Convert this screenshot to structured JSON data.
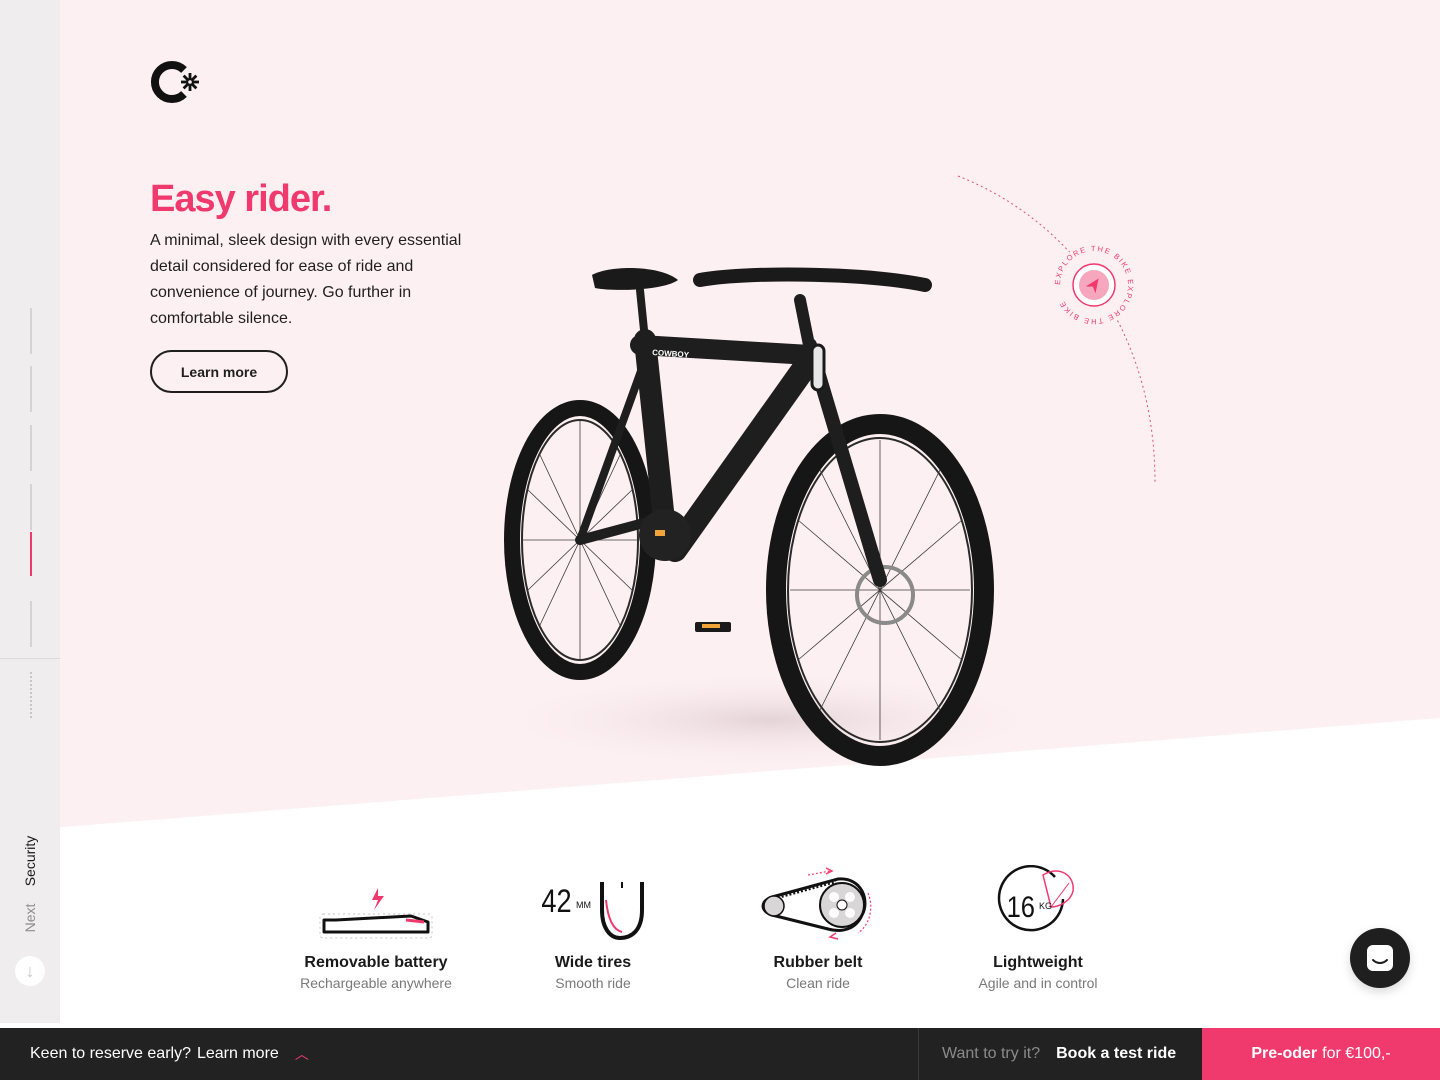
{
  "brand": {
    "logo_icon": "cowboy-logo-icon"
  },
  "sidebar": {
    "next_label": "Next",
    "section_label": "Security",
    "down_icon": "arrow-down-icon",
    "active_index": 4
  },
  "hero": {
    "title": "Easy rider.",
    "description": "A minimal, sleek design with every essential detail considered for ease of ride and convenience of journey. Go further in comfortable silence.",
    "cta_label": "Learn more",
    "bike_brand": "COWBOY",
    "explore_badge_text": "EXPLORE THE BIKE EXPLORE THE BIKE"
  },
  "features": [
    {
      "icon": "battery-icon",
      "title": "Removable battery",
      "subtitle": "Rechargeable anywhere"
    },
    {
      "icon": "tire-icon",
      "title": "Wide tires",
      "subtitle": "Smooth ride",
      "value": "42",
      "unit": "MM"
    },
    {
      "icon": "belt-icon",
      "title": "Rubber belt",
      "subtitle": "Clean ride"
    },
    {
      "icon": "feather-icon",
      "title": "Lightweight",
      "subtitle": "Agile and in control",
      "value": "16",
      "unit": "KG"
    }
  ],
  "chat": {
    "icon": "chat-icon"
  },
  "bottom_bar": {
    "reserve_question": "Keen to reserve early?",
    "reserve_link": "Learn more",
    "try_question": "Want to try it?",
    "try_link": "Book a test ride",
    "preorder_bold": "Pre-oder",
    "preorder_rest": "for €100,-"
  },
  "colors": {
    "accent": "#f03a6e",
    "hero_bg": "#fdf0f2",
    "dark": "#222222"
  }
}
